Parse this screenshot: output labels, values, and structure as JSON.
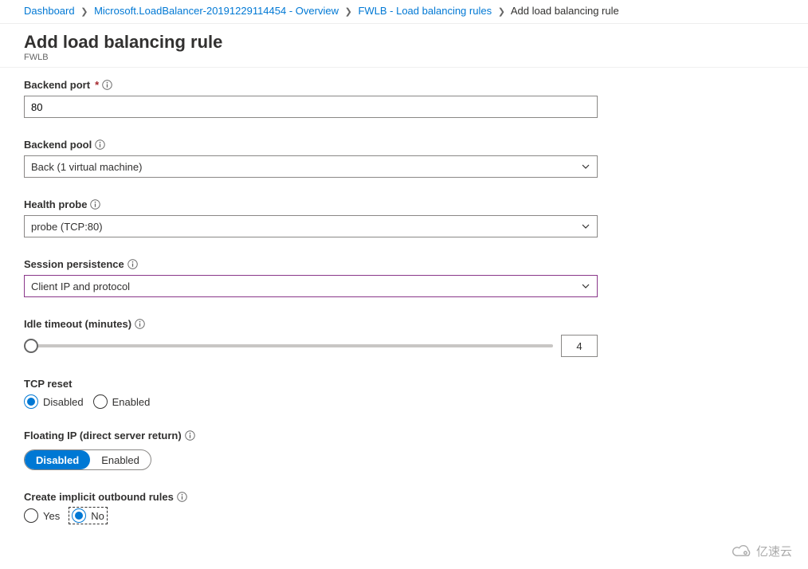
{
  "breadcrumb": {
    "dashboard": "Dashboard",
    "deployment": "Microsoft.LoadBalancer-20191229114454 - Overview",
    "rules": "FWLB - Load balancing rules",
    "current": "Add load balancing rule"
  },
  "title": {
    "heading": "Add load balancing rule",
    "subtitle": "FWLB"
  },
  "fields": {
    "backend_port": {
      "label": "Backend port",
      "required_marker": "*",
      "value": "80"
    },
    "backend_pool": {
      "label": "Backend pool",
      "value": "Back (1 virtual machine)"
    },
    "health_probe": {
      "label": "Health probe",
      "value": "probe (TCP:80)"
    },
    "session_persistence": {
      "label": "Session persistence",
      "value": "Client IP and protocol"
    },
    "idle_timeout": {
      "label": "Idle timeout (minutes)",
      "value": "4"
    },
    "tcp_reset": {
      "label": "TCP reset",
      "option_disabled": "Disabled",
      "option_enabled": "Enabled",
      "selected": "Disabled"
    },
    "floating_ip": {
      "label": "Floating IP (direct server return)",
      "option_disabled": "Disabled",
      "option_enabled": "Enabled",
      "selected": "Disabled"
    },
    "outbound_rules": {
      "label": "Create implicit outbound rules",
      "option_yes": "Yes",
      "option_no": "No",
      "selected": "No"
    }
  },
  "watermark": "亿速云"
}
